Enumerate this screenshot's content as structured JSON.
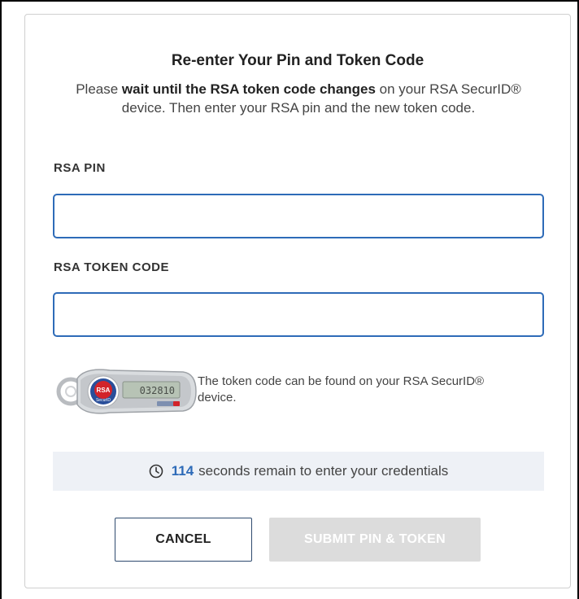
{
  "dialog": {
    "title": "Re-enter Your Pin and Token Code",
    "description_prefix": "Please ",
    "description_bold": "wait until the RSA token code changes",
    "description_suffix": " on your RSA SecurID® device. Then enter your RSA pin and the new token code."
  },
  "fields": {
    "pin_label": "RSA PIN",
    "pin_value": "",
    "token_label": "RSA TOKEN CODE",
    "token_value": ""
  },
  "device": {
    "icon": "rsa-securid-token-icon",
    "brand": "RSA",
    "brand_sub": "SecurID",
    "display_code": "032810",
    "hint": "The token code can be found on your RSA SecurID® device."
  },
  "timer": {
    "icon": "clock-icon",
    "seconds": "114",
    "text": "seconds remain to enter your credentials"
  },
  "buttons": {
    "cancel_label": "CANCEL",
    "submit_label": "SUBMIT PIN & TOKEN"
  },
  "colors": {
    "accent": "#2e6bb8",
    "timer_background": "#eef1f6",
    "submit_disabled": "#dcdcdc",
    "rsa_red": "#d2232a"
  }
}
